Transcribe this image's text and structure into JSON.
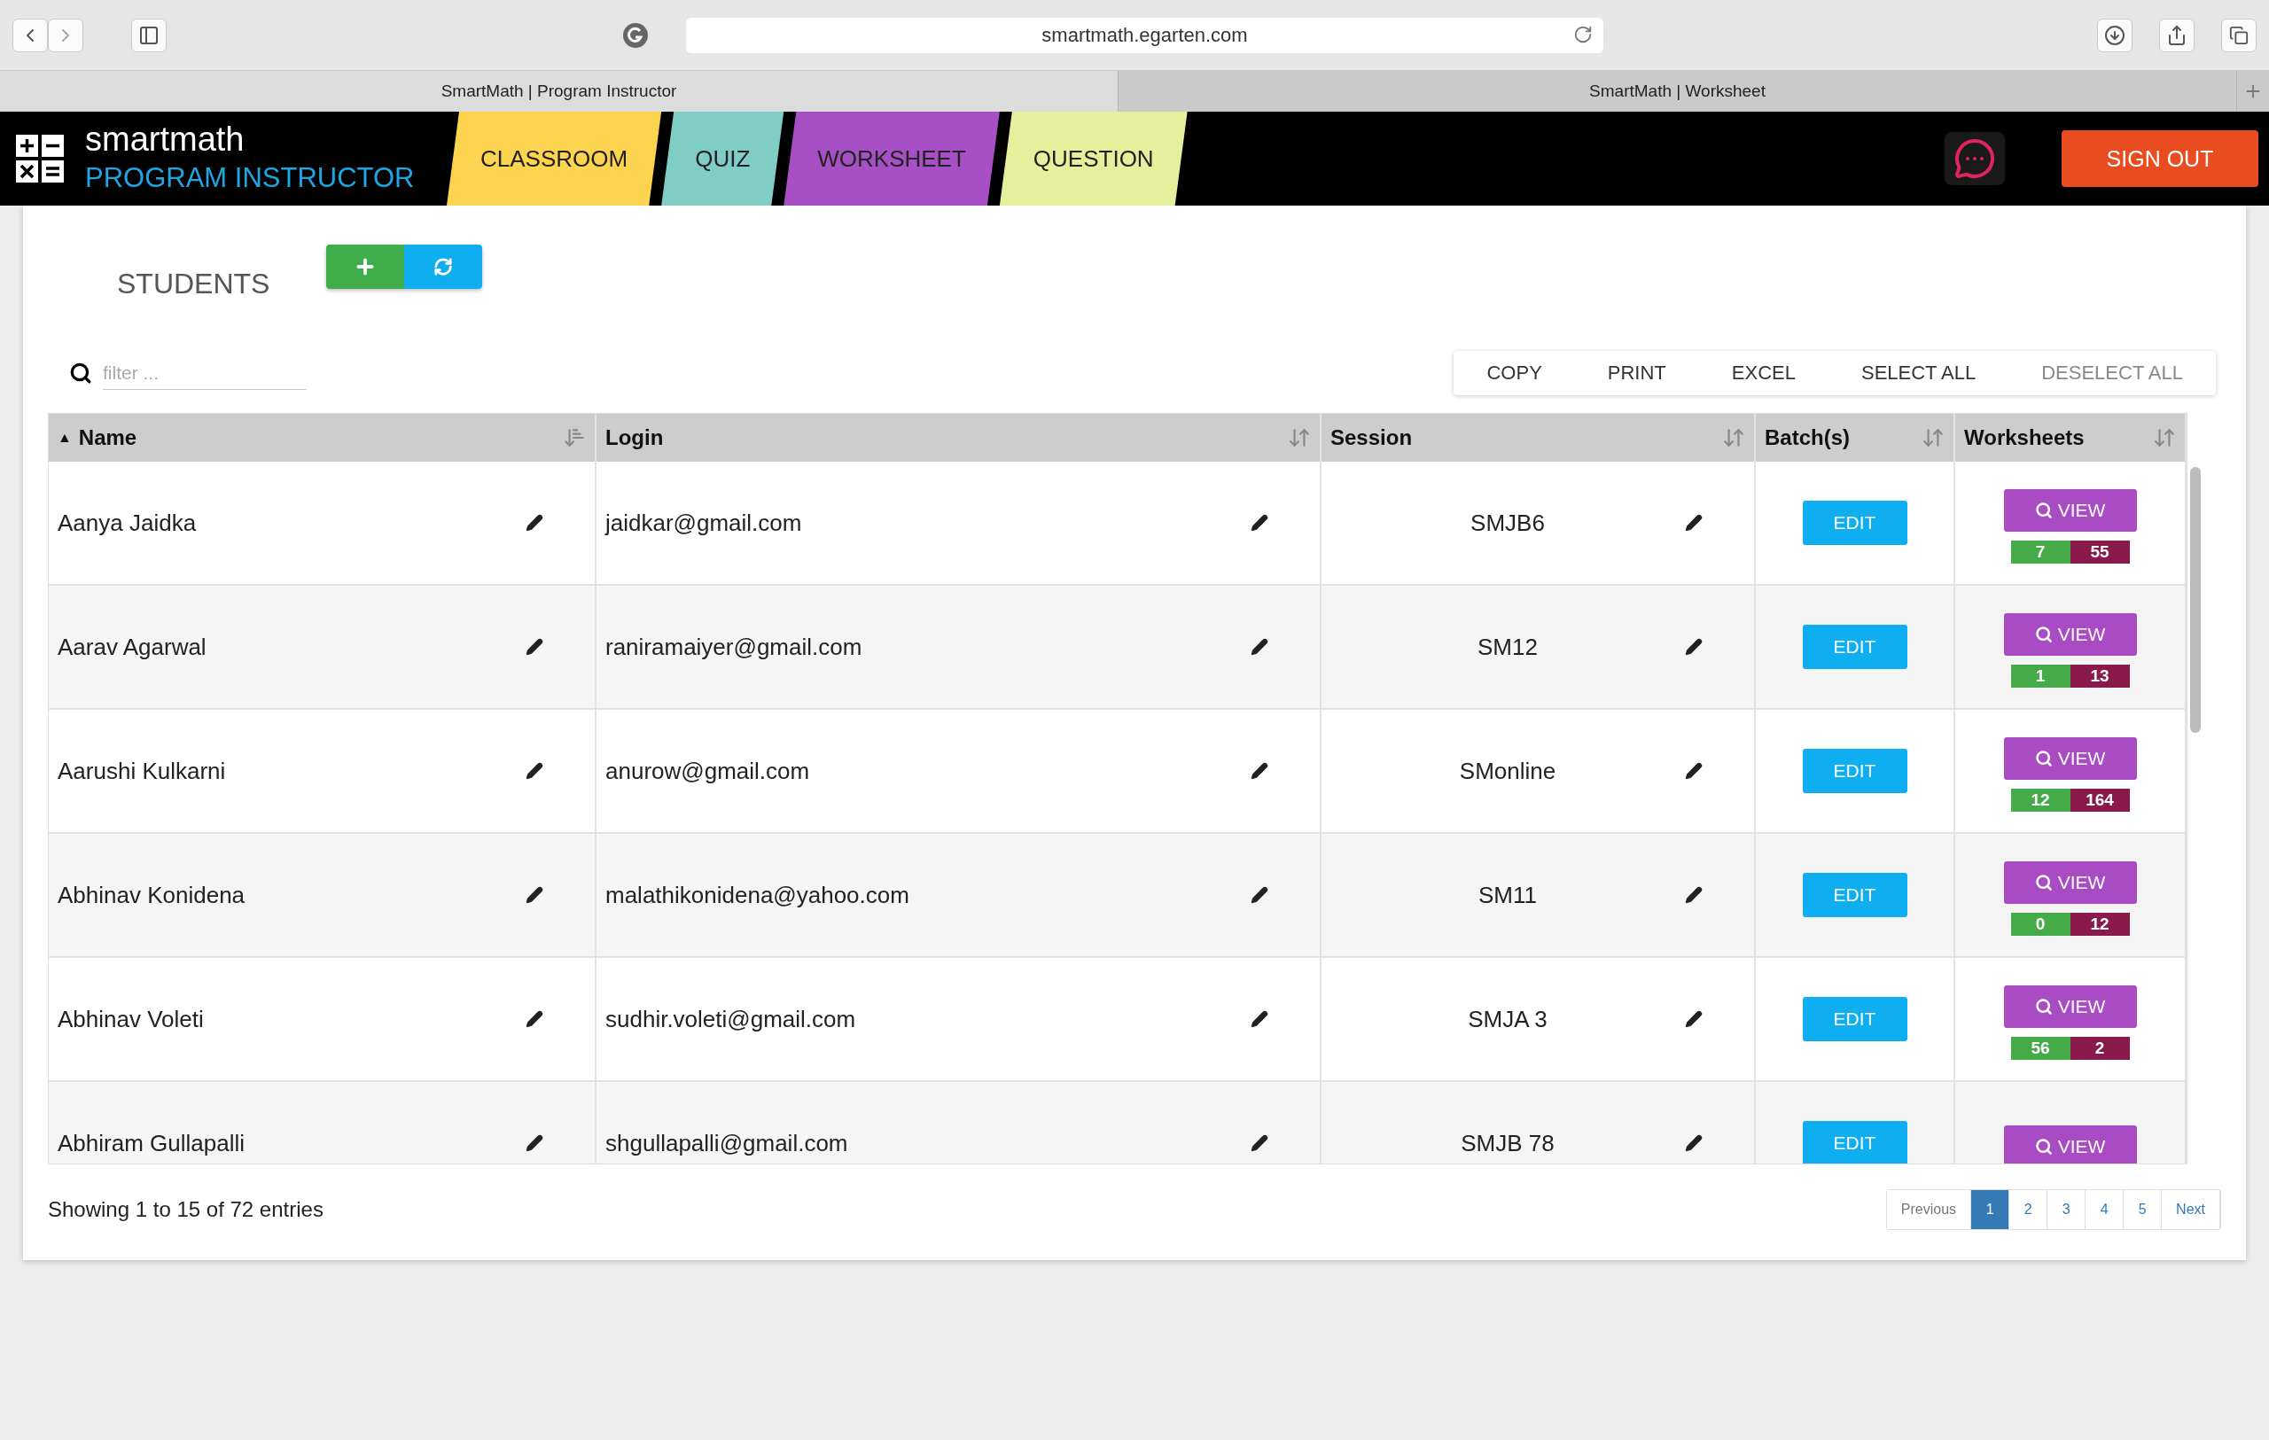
{
  "browser": {
    "url": "smartmath.egarten.com",
    "tabs": [
      {
        "label": "SmartMath | Program Instructor",
        "selected": true
      },
      {
        "label": "SmartMath | Worksheet",
        "selected": false
      }
    ]
  },
  "header": {
    "brand": "smartmath",
    "subtitle": "PROGRAM INSTRUCTOR",
    "nav": [
      {
        "label": "CLASSROOM",
        "color": "#fdd450"
      },
      {
        "label": "QUIZ",
        "color": "#7fcdc5"
      },
      {
        "label": "WORKSHEET",
        "color": "#a74fc4"
      },
      {
        "label": "QUESTION",
        "color": "#e6ef9c"
      }
    ],
    "sign_out": "SIGN OUT"
  },
  "page": {
    "title": "STUDENTS",
    "filter": {
      "placeholder": "filter ..."
    },
    "actions": [
      {
        "label": "COPY",
        "disabled": false
      },
      {
        "label": "PRINT",
        "disabled": false
      },
      {
        "label": "EXCEL",
        "disabled": false
      },
      {
        "label": "SELECT ALL",
        "disabled": false
      },
      {
        "label": "DESELECT ALL",
        "disabled": true
      }
    ]
  },
  "table": {
    "columns": [
      {
        "label": "Name",
        "sort_indicator": "▲"
      },
      {
        "label": "Login"
      },
      {
        "label": "Session"
      },
      {
        "label": "Batch(s)"
      },
      {
        "label": "Worksheets"
      }
    ],
    "rows": [
      {
        "name": "Aanya Jaidka",
        "login": "jaidkar@gmail.com",
        "session": "SMJB6",
        "batch": "EDIT",
        "view": "VIEW",
        "counts": [
          "7",
          "55"
        ]
      },
      {
        "name": "Aarav Agarwal",
        "login": "raniramaiyer@gmail.com",
        "session": "SM12",
        "batch": "EDIT",
        "view": "VIEW",
        "counts": [
          "1",
          "13"
        ]
      },
      {
        "name": "Aarushi Kulkarni",
        "login": "anurow@gmail.com",
        "session": "SMonline",
        "batch": "EDIT",
        "view": "VIEW",
        "counts": [
          "12",
          "164"
        ]
      },
      {
        "name": "Abhinav Konidena",
        "login": "malathikonidena@yahoo.com",
        "session": "SM11",
        "batch": "EDIT",
        "view": "VIEW",
        "counts": [
          "0",
          "12"
        ]
      },
      {
        "name": "Abhinav Voleti",
        "login": "sudhir.voleti@gmail.com",
        "session": "SMJA 3",
        "batch": "EDIT",
        "view": "VIEW",
        "counts": [
          "56",
          "2"
        ]
      },
      {
        "name": "Abhiram Gullapalli",
        "login": "shgullapalli@gmail.com",
        "session": "SMJB 78",
        "batch": "EDIT",
        "view": "VIEW"
      }
    ],
    "summary": "Showing 1 to 15 of 72 entries",
    "pagination": {
      "previous": "Previous",
      "pages": [
        {
          "label": "1",
          "selected": true
        },
        {
          "label": "2",
          "selected": false
        },
        {
          "label": "3",
          "selected": false
        },
        {
          "label": "4",
          "selected": false
        },
        {
          "label": "5",
          "selected": false
        }
      ],
      "next": "Next"
    }
  }
}
